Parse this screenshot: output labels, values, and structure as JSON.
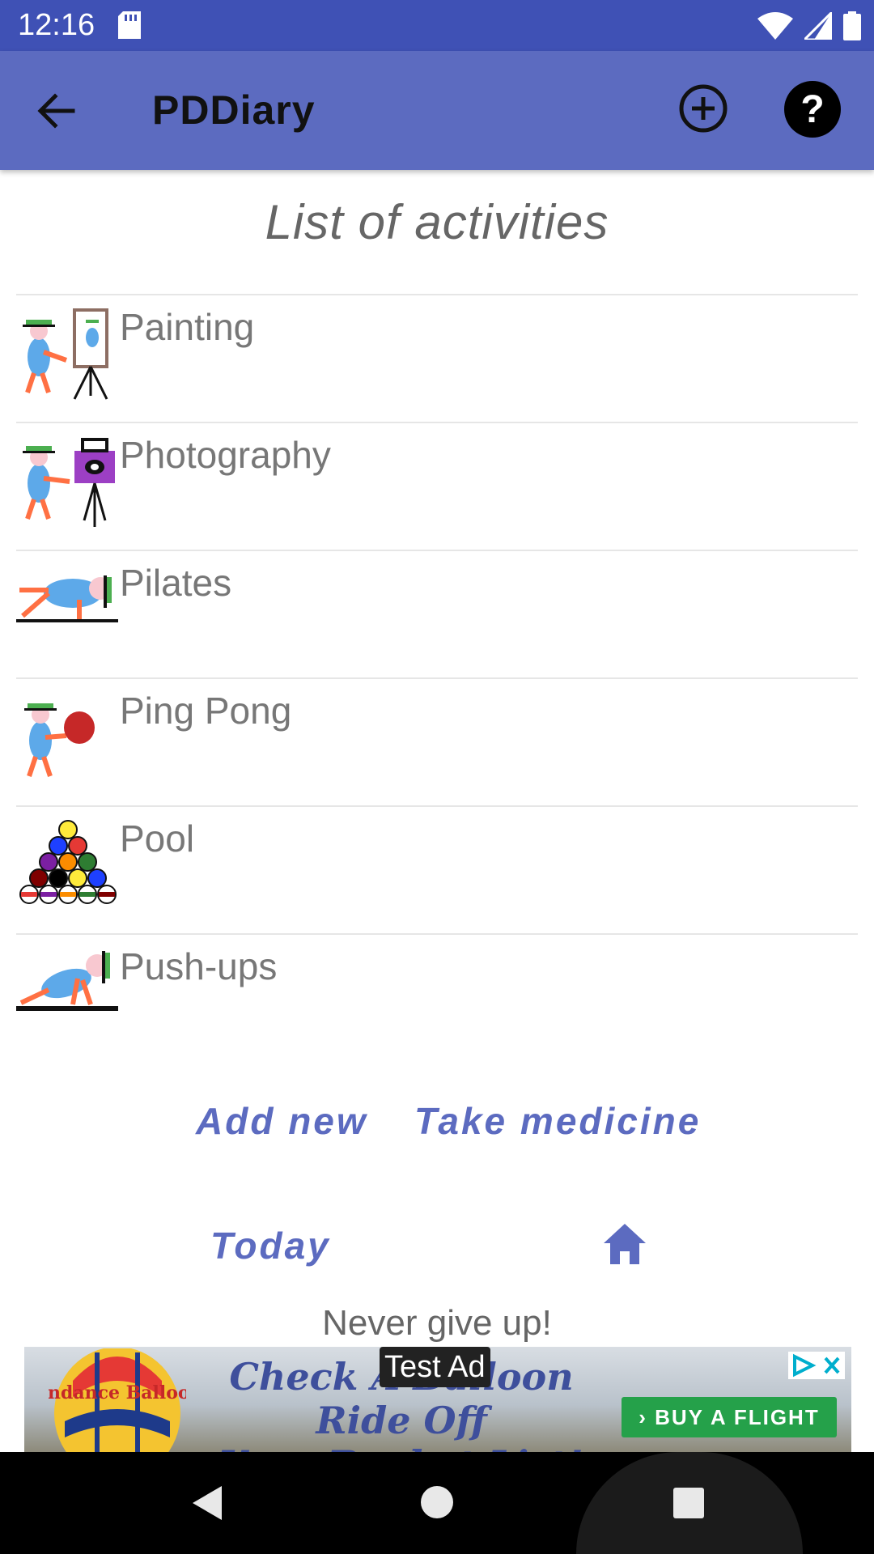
{
  "status_bar": {
    "time": "12:16"
  },
  "app_bar": {
    "title": "PDDiary"
  },
  "heading": "List of activities",
  "activities": [
    {
      "label": "Painting",
      "icon": "painter-easel-icon"
    },
    {
      "label": "Photography",
      "icon": "camera-tripod-icon"
    },
    {
      "label": "Pilates",
      "icon": "pilates-plank-icon"
    },
    {
      "label": "Ping Pong",
      "icon": "ping-pong-paddle-icon"
    },
    {
      "label": "Pool",
      "icon": "pool-balls-rack-icon"
    },
    {
      "label": "Push-ups",
      "icon": "push-up-icon"
    }
  ],
  "actions": {
    "add_new": "Add new",
    "take_medicine": "Take medicine",
    "today": "Today"
  },
  "motto": "Never give up!",
  "ad": {
    "badge": "Test Ad",
    "headline_line1": "Check A Balloon Ride Off",
    "headline_line2": "Your Bucket List!",
    "cta": "›  BUY A FLIGHT",
    "balloon_text": "Sundance Balloons"
  },
  "colors": {
    "status_bar": "#3f51b5",
    "app_bar": "#5c6bc0",
    "accent_text": "#5c6bc0"
  }
}
